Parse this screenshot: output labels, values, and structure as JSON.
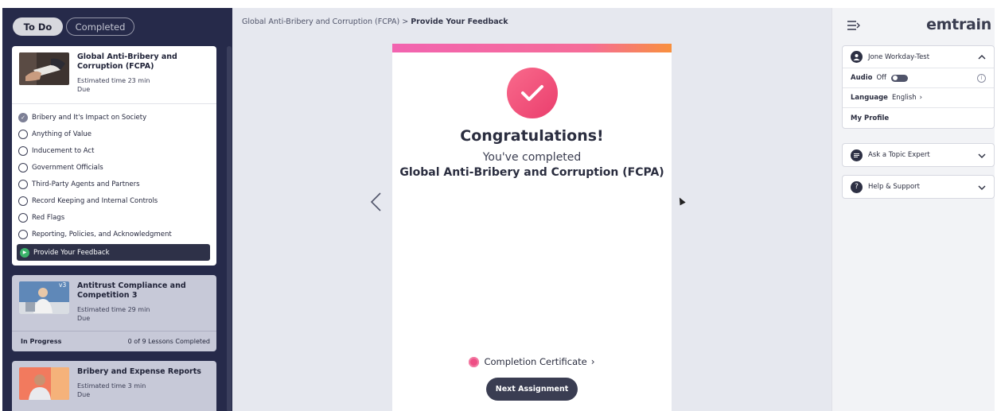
{
  "tabs": {
    "todo": "To Do",
    "completed": "Completed"
  },
  "courses": [
    {
      "title": "Global Anti-Bribery and Corruption (FCPA)",
      "time": "Estimated time 23 min",
      "due": "Due",
      "lessons": [
        {
          "label": "Bribery and It's Impact on Society",
          "status": "done"
        },
        {
          "label": "Anything of Value",
          "status": "todo"
        },
        {
          "label": "Inducement to Act",
          "status": "todo"
        },
        {
          "label": "Government Officials",
          "status": "todo"
        },
        {
          "label": "Third-Party Agents and Partners",
          "status": "todo"
        },
        {
          "label": "Record Keeping and Internal Controls",
          "status": "todo"
        },
        {
          "label": "Red Flags",
          "status": "todo"
        },
        {
          "label": "Reporting, Policies, and Acknowledgment",
          "status": "todo"
        },
        {
          "label": "Provide Your Feedback",
          "status": "current"
        }
      ]
    },
    {
      "title": "Antitrust Compliance and Competition 3",
      "time": "Estimated time 29 min",
      "due": "Due",
      "badge": "v3",
      "status": "In Progress",
      "progress": "0 of 9 Lessons Completed"
    },
    {
      "title": "Bribery and Expense Reports",
      "time": "Estimated time 3 min",
      "due": "Due"
    }
  ],
  "breadcrumb": {
    "course": "Global Anti-Bribery and Corruption (FCPA)",
    "sep": ">",
    "current": "Provide Your Feedback"
  },
  "panel": {
    "heading": "Congratulations!",
    "subheading": "You've completed",
    "course": "Global Anti-Bribery and Corruption (FCPA)",
    "certificate": "Completion Certificate",
    "next": "Next Assignment"
  },
  "right": {
    "brand": "emtrain",
    "user": "Jone Workday-Test",
    "audio_label": "Audio",
    "audio_value": "Off",
    "language_label": "Language",
    "language_value": "English",
    "profile": "My Profile",
    "expert": "Ask a Topic Expert",
    "help": "Help & Support"
  },
  "colors": {
    "accent": "#ea3e6d",
    "sidebar": "#262a4a",
    "current_lesson": "#3bb36a"
  }
}
